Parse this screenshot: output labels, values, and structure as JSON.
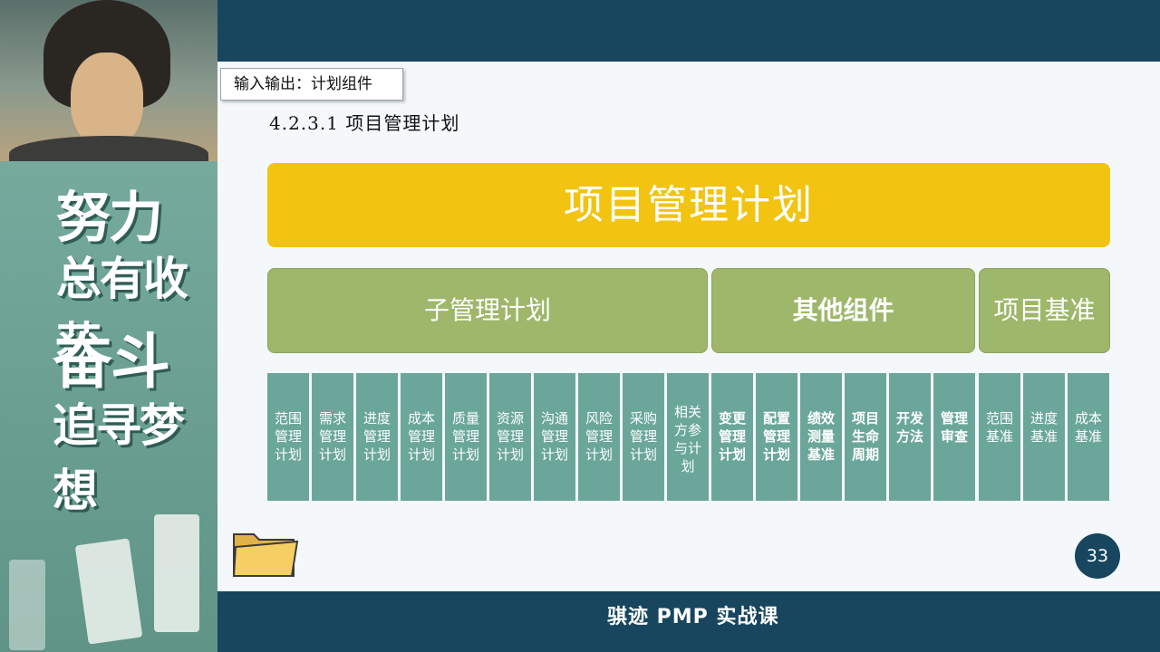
{
  "banner": {
    "line1": "努力",
    "line2": "总有收获",
    "line3": "奋斗",
    "line4": "追寻梦想"
  },
  "slide": {
    "section_tag": "输入输出：计划组件",
    "heading": "4.2.3.1 项目管理计划",
    "plan_title": "项目管理计划",
    "categories": {
      "sub_plans": "子管理计划",
      "other_components": "其他组件",
      "baselines": "项目基准"
    },
    "items": [
      {
        "lines": [
          "范围",
          "管理",
          "计划"
        ]
      },
      {
        "lines": [
          "需求",
          "管理",
          "计划"
        ]
      },
      {
        "lines": [
          "进度",
          "管理",
          "计划"
        ]
      },
      {
        "lines": [
          "成本",
          "管理",
          "计划"
        ]
      },
      {
        "lines": [
          "质量",
          "管理",
          "计划"
        ]
      },
      {
        "lines": [
          "资源",
          "管理",
          "计划"
        ]
      },
      {
        "lines": [
          "沟通",
          "管理",
          "计划"
        ]
      },
      {
        "lines": [
          "风险",
          "管理",
          "计划"
        ]
      },
      {
        "lines": [
          "采购",
          "管理",
          "计划"
        ]
      },
      {
        "lines": [
          "相关",
          "方参",
          "与计",
          "划"
        ]
      },
      {
        "lines": [
          "变更",
          "管理",
          "计划"
        ]
      },
      {
        "lines": [
          "配置",
          "管理",
          "计划"
        ]
      },
      {
        "lines": [
          "绩效",
          "测量",
          "基准"
        ]
      },
      {
        "lines": [
          "项目",
          "生命",
          "周期"
        ]
      },
      {
        "lines": [
          "开发",
          "方法"
        ]
      },
      {
        "lines": [
          "管理",
          "审查"
        ]
      },
      {
        "lines": [
          "范围",
          "基准"
        ]
      },
      {
        "lines": [
          "进度",
          "基准"
        ]
      },
      {
        "lines": [
          "成本",
          "基准"
        ]
      }
    ],
    "page_number": "33"
  },
  "footer": {
    "course_name": "骐迹 PMP 实战课"
  },
  "colors": {
    "plan": "#f2c311",
    "category": "#9eb76a",
    "item": "#6aa79a",
    "bar": "#17465e"
  }
}
